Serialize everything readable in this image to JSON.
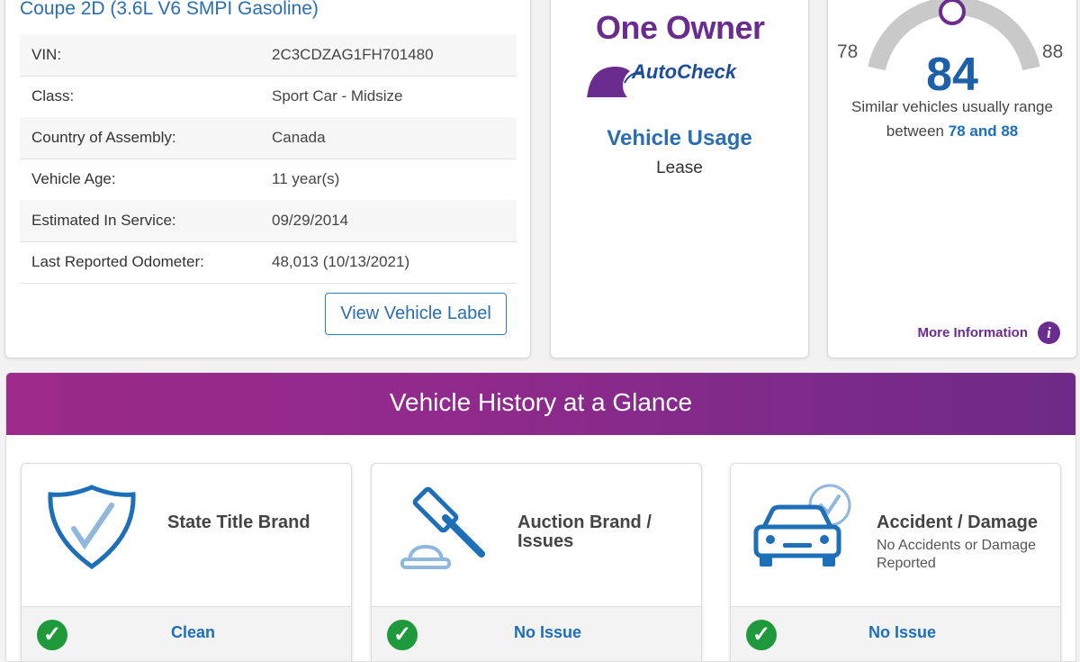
{
  "vehicle_info": {
    "subtitle": "Coupe 2D (3.6L V6 SMPI Gasoline)",
    "specs": [
      {
        "label": "VIN:",
        "value": "2C3CDZAG1FH701480"
      },
      {
        "label": "Class:",
        "value": "Sport Car - Midsize"
      },
      {
        "label": "Country of Assembly:",
        "value": "Canada"
      },
      {
        "label": "Vehicle Age:",
        "value": "11 year(s)"
      },
      {
        "label": "Estimated In Service:",
        "value": "09/29/2014"
      },
      {
        "label": "Last Reported Odometer:",
        "value": "48,013 (10/13/2021)"
      }
    ],
    "view_label_button": "View Vehicle Label"
  },
  "owner": {
    "one_owner": "One Owner",
    "autocheck": "AutoCheck",
    "usage_title": "Vehicle Usage",
    "usage_value": "Lease"
  },
  "score": {
    "range_low": "78",
    "range_high": "88",
    "value": "84",
    "text_line_1": "Similar vehicles usually range",
    "text_between": "between",
    "text_range": "78 and 88",
    "more_info": "More Information",
    "more_info_icon": "i"
  },
  "history": {
    "title": "Vehicle History at a Glance",
    "cards": [
      {
        "title": "State Title Brand",
        "subtitle": "",
        "status": "Clean",
        "icon": "shield-check-icon"
      },
      {
        "title": "Auction Brand / Issues",
        "subtitle": "",
        "status": "No Issue",
        "icon": "gavel-icon"
      },
      {
        "title": "Accident / Damage",
        "subtitle": "No Accidents or Damage Reported",
        "status": "No Issue",
        "icon": "car-check-icon"
      }
    ],
    "check_glyph": "✓"
  },
  "colors": {
    "accent_blue": "#1d6fb8",
    "brand_purple": "#6b2c8f",
    "check_green": "#1e9a3c"
  }
}
